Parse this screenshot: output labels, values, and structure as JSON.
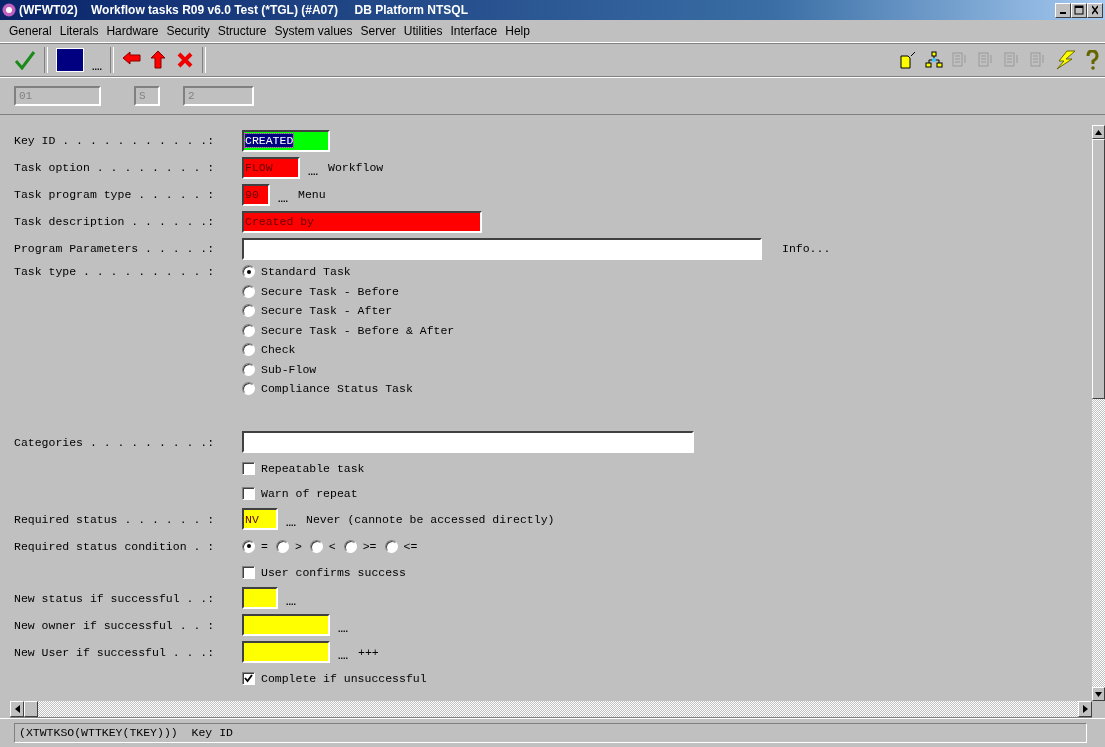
{
  "window": {
    "title": "(WFWT02)    Workflow tasks R09 v6.0 Test (*TGL) (#A07)     DB Platform NTSQL"
  },
  "menu": [
    "General",
    "Literals",
    "Hardware",
    "Security",
    "Structure",
    "System values",
    "Server",
    "Utilities",
    "Interface",
    "Help"
  ],
  "toolbar": {
    "lookup": "...."
  },
  "header_fields": [
    {
      "value": "01",
      "disabled": true
    },
    {
      "value": "S",
      "disabled": true
    },
    {
      "value": "2",
      "disabled": true
    }
  ],
  "form": {
    "rows": [
      {
        "kind": "field",
        "label": "Key ID . . . . . . . . . . .:",
        "value": "CREATED",
        "color": "#00ff00",
        "highlighted": true
      },
      {
        "kind": "field",
        "label": "Task option . . . . . . . . :",
        "value": "FLOW",
        "color": "#ff0000",
        "lookup": "....",
        "note": "Workflow"
      },
      {
        "kind": "field",
        "label": "Task program type . . . . . :",
        "value": "90",
        "color": "#ff0000",
        "lookup": "....",
        "note": "Menu"
      },
      {
        "kind": "field",
        "label": "Task description . . . . . .:",
        "value": "Created by",
        "color": "#ff0000"
      },
      {
        "kind": "field",
        "label": "Program Parameters . . . . .:",
        "value": "",
        "color": "#ffffff",
        "link": "Info..."
      },
      {
        "kind": "radio-group",
        "label": "Task type . . . . . . . . . :",
        "options": [
          {
            "label": "Standard Task",
            "selected": true
          },
          {
            "label": "Secure Task - Before",
            "selected": false
          },
          {
            "label": "Secure Task - After",
            "selected": false
          },
          {
            "label": "Secure Task - Before & After",
            "selected": false
          },
          {
            "label": "Check",
            "selected": false
          },
          {
            "label": "Sub-Flow",
            "selected": false
          },
          {
            "label": "Compliance Status Task",
            "selected": false
          }
        ]
      },
      {
        "kind": "field",
        "label": "Categories . . . . . . . . .:",
        "value": "",
        "color": "#ffffff"
      },
      {
        "kind": "checkbox",
        "label": "Repeatable task",
        "checked": false
      },
      {
        "kind": "checkbox",
        "label": "Warn of repeat",
        "checked": false
      },
      {
        "kind": "field",
        "label": "Required status . . . . . . :",
        "value": "NV",
        "color": "#ffff00",
        "lookup": "....",
        "note": "Never (cannote be accessed directly)"
      },
      {
        "kind": "radio-row",
        "label": "Required status condition . :",
        "options": [
          {
            "label": "=",
            "selected": true
          },
          {
            "label": ">",
            "selected": false
          },
          {
            "label": "<",
            "selected": false
          },
          {
            "label": ">=",
            "selected": false
          },
          {
            "label": "<=",
            "selected": false
          }
        ]
      },
      {
        "kind": "checkbox",
        "label": "User confirms success",
        "checked": false
      },
      {
        "kind": "field",
        "label": "New status if successful . .:",
        "value": "",
        "color": "#ffff00",
        "lookup": "...."
      },
      {
        "kind": "field",
        "label": "New owner if successful . . :",
        "value": "",
        "color": "#ffff00",
        "lookup": "...."
      },
      {
        "kind": "field",
        "label": "New User if successful . . .:",
        "value": "",
        "color": "#ffff00",
        "lookup": "....",
        "note": "+++"
      },
      {
        "kind": "checkbox",
        "label": "Complete if unsuccessful",
        "checked": true
      }
    ]
  },
  "status_bar": {
    "text": "(XTWTKSO(WTTKEY(TKEY)))  Key ID"
  }
}
